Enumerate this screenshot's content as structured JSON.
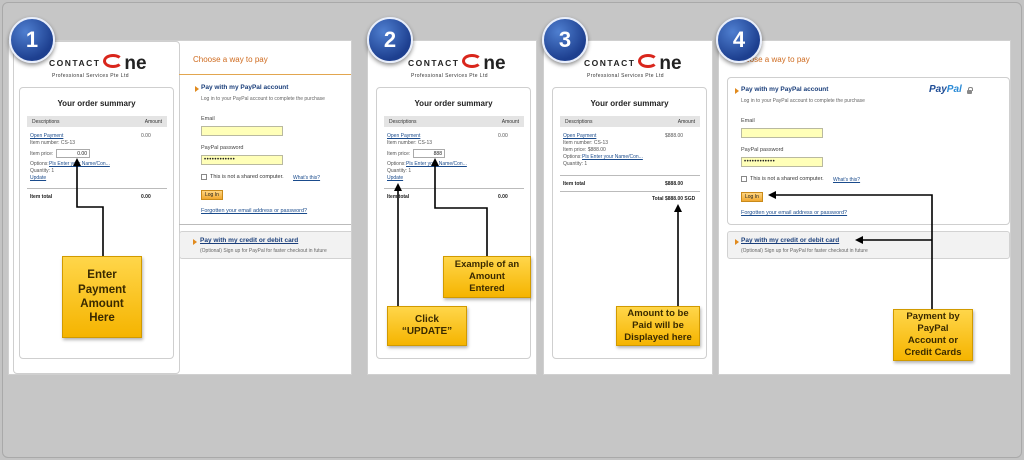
{
  "steps": [
    "1",
    "2",
    "3",
    "4"
  ],
  "logo": {
    "prefix": "CONTACT",
    "suffix": "ne",
    "sub": "Professional Services Pte Ltd"
  },
  "order_summary": {
    "title": "Your order summary",
    "col_desc": "Descriptions",
    "col_amount": "Amount",
    "item_name": "Open Payment",
    "item_number": "Item number: CS-13",
    "item_price_label": "Item price:",
    "options_label": "Options:",
    "options_value": "Pls Enter your Name/Con...",
    "quantity": "Quantity: 1",
    "update_link": "Update",
    "item_total_label": "Item total"
  },
  "panel1": {
    "amount": "0.00",
    "price_value": "0.00",
    "total": "0.00"
  },
  "panel2": {
    "amount": "0.00",
    "price_value": "888",
    "total": "0.00"
  },
  "panel3": {
    "amount": "$888.00",
    "item_price_text": "Item price: $888.00",
    "total": "$888.00",
    "grand_total": "Total $888.00 SGD"
  },
  "pay": {
    "choose_title": "Choose a way to pay",
    "paypal_title": "Pay with my PayPal account",
    "paypal_sub": "Log in to your PayPal account to complete the purchase",
    "email_label": "Email",
    "password_label": "PayPal password",
    "password_value": "••••••••••••",
    "shared_label": "This is not a shared computer.",
    "whats_this": "What's this?",
    "login_button": "Log In",
    "forgot_link": "Forgotten your email address or password?",
    "card_title": "Pay with my credit or debit card",
    "card_sub": "(Optional) Sign up for PayPal for faster checkout in future",
    "paypal_logo_a": "Pay",
    "paypal_logo_b": "Pal"
  },
  "callouts": {
    "enter_amount": "Enter\nPayment\nAmount\nHere",
    "example_amount": "Example of an\nAmount\nEntered",
    "click_update": "Click\n“UPDATE”",
    "amount_displayed": "Amount to be\nPaid will be\nDisplayed here",
    "payment_by": "Payment by\nPayPal\nAccount or\nCredit Cards"
  },
  "colors": {
    "accent_orange": "#cf6b1f",
    "note_yellow": "#f5b400",
    "badge_blue": "#1d3f8f",
    "link_blue": "#1a4b8c"
  }
}
